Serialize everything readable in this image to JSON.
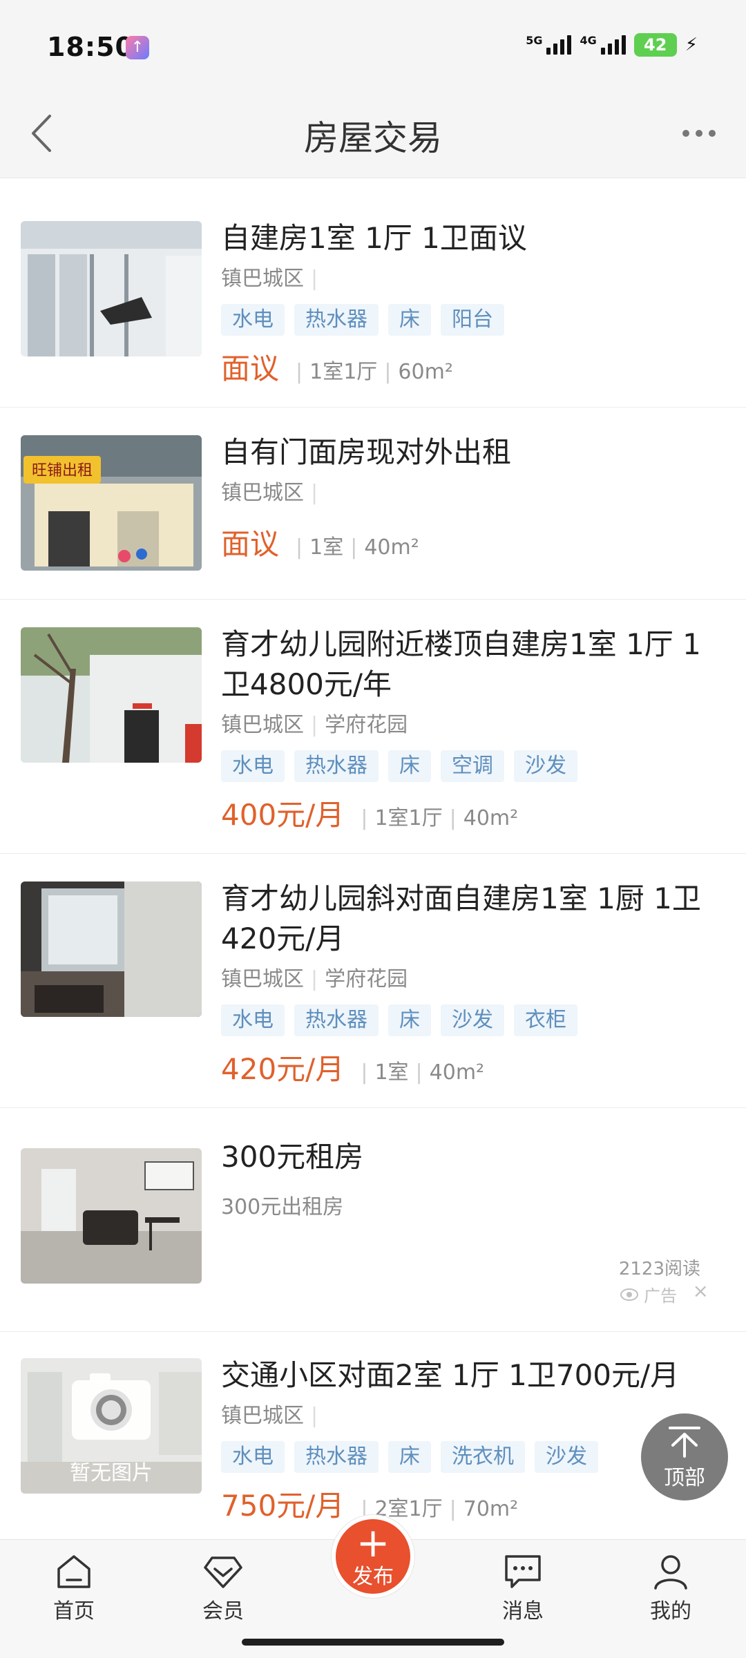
{
  "status_bar": {
    "time": "18:50",
    "network1": "5G",
    "network2": "4G",
    "battery": "42"
  },
  "header": {
    "title": "房屋交易"
  },
  "listings": [
    {
      "title": "自建房1室 1厅 1卫面议",
      "location": "镇巴城区",
      "community": "",
      "tags": [
        "水电",
        "热水器",
        "床",
        "阳台"
      ],
      "price": "面议",
      "layout": "1室1厅",
      "area": "60m²"
    },
    {
      "title": "自有门面房现对外出租",
      "location": "镇巴城区",
      "community": "",
      "thumb_text": "旺铺出租",
      "tags": [],
      "price": "面议",
      "layout": "1室",
      "area": "40m²"
    },
    {
      "title": "育才幼儿园附近楼顶自建房1室 1厅 1卫4800元/年",
      "location": "镇巴城区",
      "community": "学府花园",
      "tags": [
        "水电",
        "热水器",
        "床",
        "空调",
        "沙发"
      ],
      "price": "400元/月",
      "layout": "1室1厅",
      "area": "40m²"
    },
    {
      "title": "育才幼儿园斜对面自建房1室 1厨 1卫420元/月",
      "location": "镇巴城区",
      "community": "学府花园",
      "tags": [
        "水电",
        "热水器",
        "床",
        "沙发",
        "衣柜"
      ],
      "price": "420元/月",
      "layout": "1室",
      "area": "40m²"
    }
  ],
  "ad": {
    "title": "300元租房",
    "subtitle": "300元出租房",
    "reads": "2123阅读",
    "label": "广告",
    "close": "×"
  },
  "listing_last": {
    "title": "交通小区对面2室 1厅 1卫700元/月",
    "location": "镇巴城区",
    "thumb_text": "暂无图片",
    "tags": [
      "水电",
      "热水器",
      "床",
      "洗衣机",
      "沙发"
    ],
    "price": "750元/月",
    "layout": "2室1厅",
    "area": "70m²"
  },
  "to_top": {
    "label": "顶部"
  },
  "bottom_nav": {
    "home": "首页",
    "member": "会员",
    "publish": "发布",
    "publish_plus": "+",
    "messages": "消息",
    "mine": "我的"
  },
  "colors": {
    "price": "#e0612c",
    "tag_bg": "#eef5fb",
    "tag_text": "#5e8fbd",
    "publish": "#e8502e"
  }
}
